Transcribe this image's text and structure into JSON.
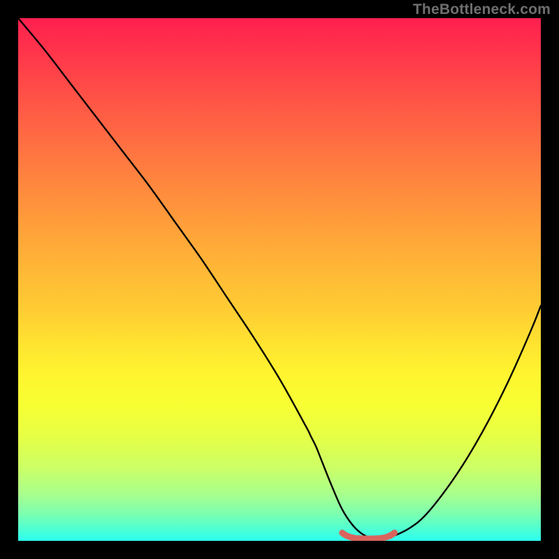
{
  "watermark": "TheBottleneck.com",
  "chart_data": {
    "type": "line",
    "title": "",
    "xlabel": "",
    "ylabel": "",
    "xlim": [
      0,
      100
    ],
    "ylim": [
      0,
      100
    ],
    "grid": false,
    "colors": {
      "curve": "#000000",
      "trough_marker": "#d9645e",
      "background_top": "#ff1f4e",
      "background_bottom": "#2cffef",
      "frame": "#000000"
    },
    "series": [
      {
        "name": "bottleneck-curve",
        "x": [
          0,
          5,
          10,
          15,
          20,
          25,
          30,
          35,
          40,
          45,
          50,
          55,
          56,
          57,
          58,
          60,
          62,
          64,
          66,
          68,
          70,
          72,
          75,
          78,
          82,
          86,
          90,
          94,
          98,
          100
        ],
        "y": [
          100,
          94,
          87.5,
          81,
          74.5,
          68,
          61,
          54,
          46.5,
          39,
          31,
          22,
          20,
          18,
          15.5,
          10.5,
          6,
          3,
          1.2,
          0.5,
          0.5,
          1,
          2.5,
          5,
          10,
          16,
          23,
          31,
          40,
          45
        ]
      }
    ],
    "annotations": [
      {
        "name": "optimal-range-marker",
        "shape": "rounded-segment",
        "x_start": 62,
        "x_end": 72,
        "y": 1.0,
        "color": "#d9645e"
      }
    ]
  }
}
